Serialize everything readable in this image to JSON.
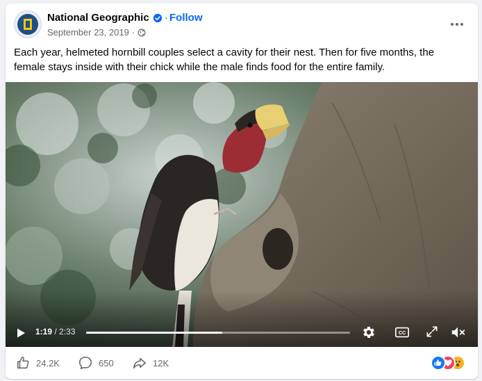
{
  "post": {
    "page_name": "National Geographic",
    "follow_label": "Follow",
    "date": "September 23, 2019",
    "audience_icon": "globe-icon",
    "more_icon": "more-options-icon",
    "caption": "Each year, helmeted hornbill couples select a cavity for their nest. Then for five months, the female stays inside with their chick while the male finds food for the entire family."
  },
  "video": {
    "current_time": "1:19",
    "duration": "/ 2:33",
    "progress": 0.516,
    "icons": [
      "play-icon",
      "settings-gear-icon",
      "captions-icon",
      "fullscreen-icon",
      "mute-icon"
    ]
  },
  "footer": {
    "likes": "24.2K",
    "comments": "650",
    "shares": "12K",
    "reaction_icons": [
      "like-reaction-icon",
      "love-reaction-icon",
      "wow-reaction-icon"
    ]
  },
  "colors": {
    "brand_blue": "#0866ff",
    "ng_yellow": "#f7c600",
    "text": "#050505",
    "muted": "#65676b"
  }
}
